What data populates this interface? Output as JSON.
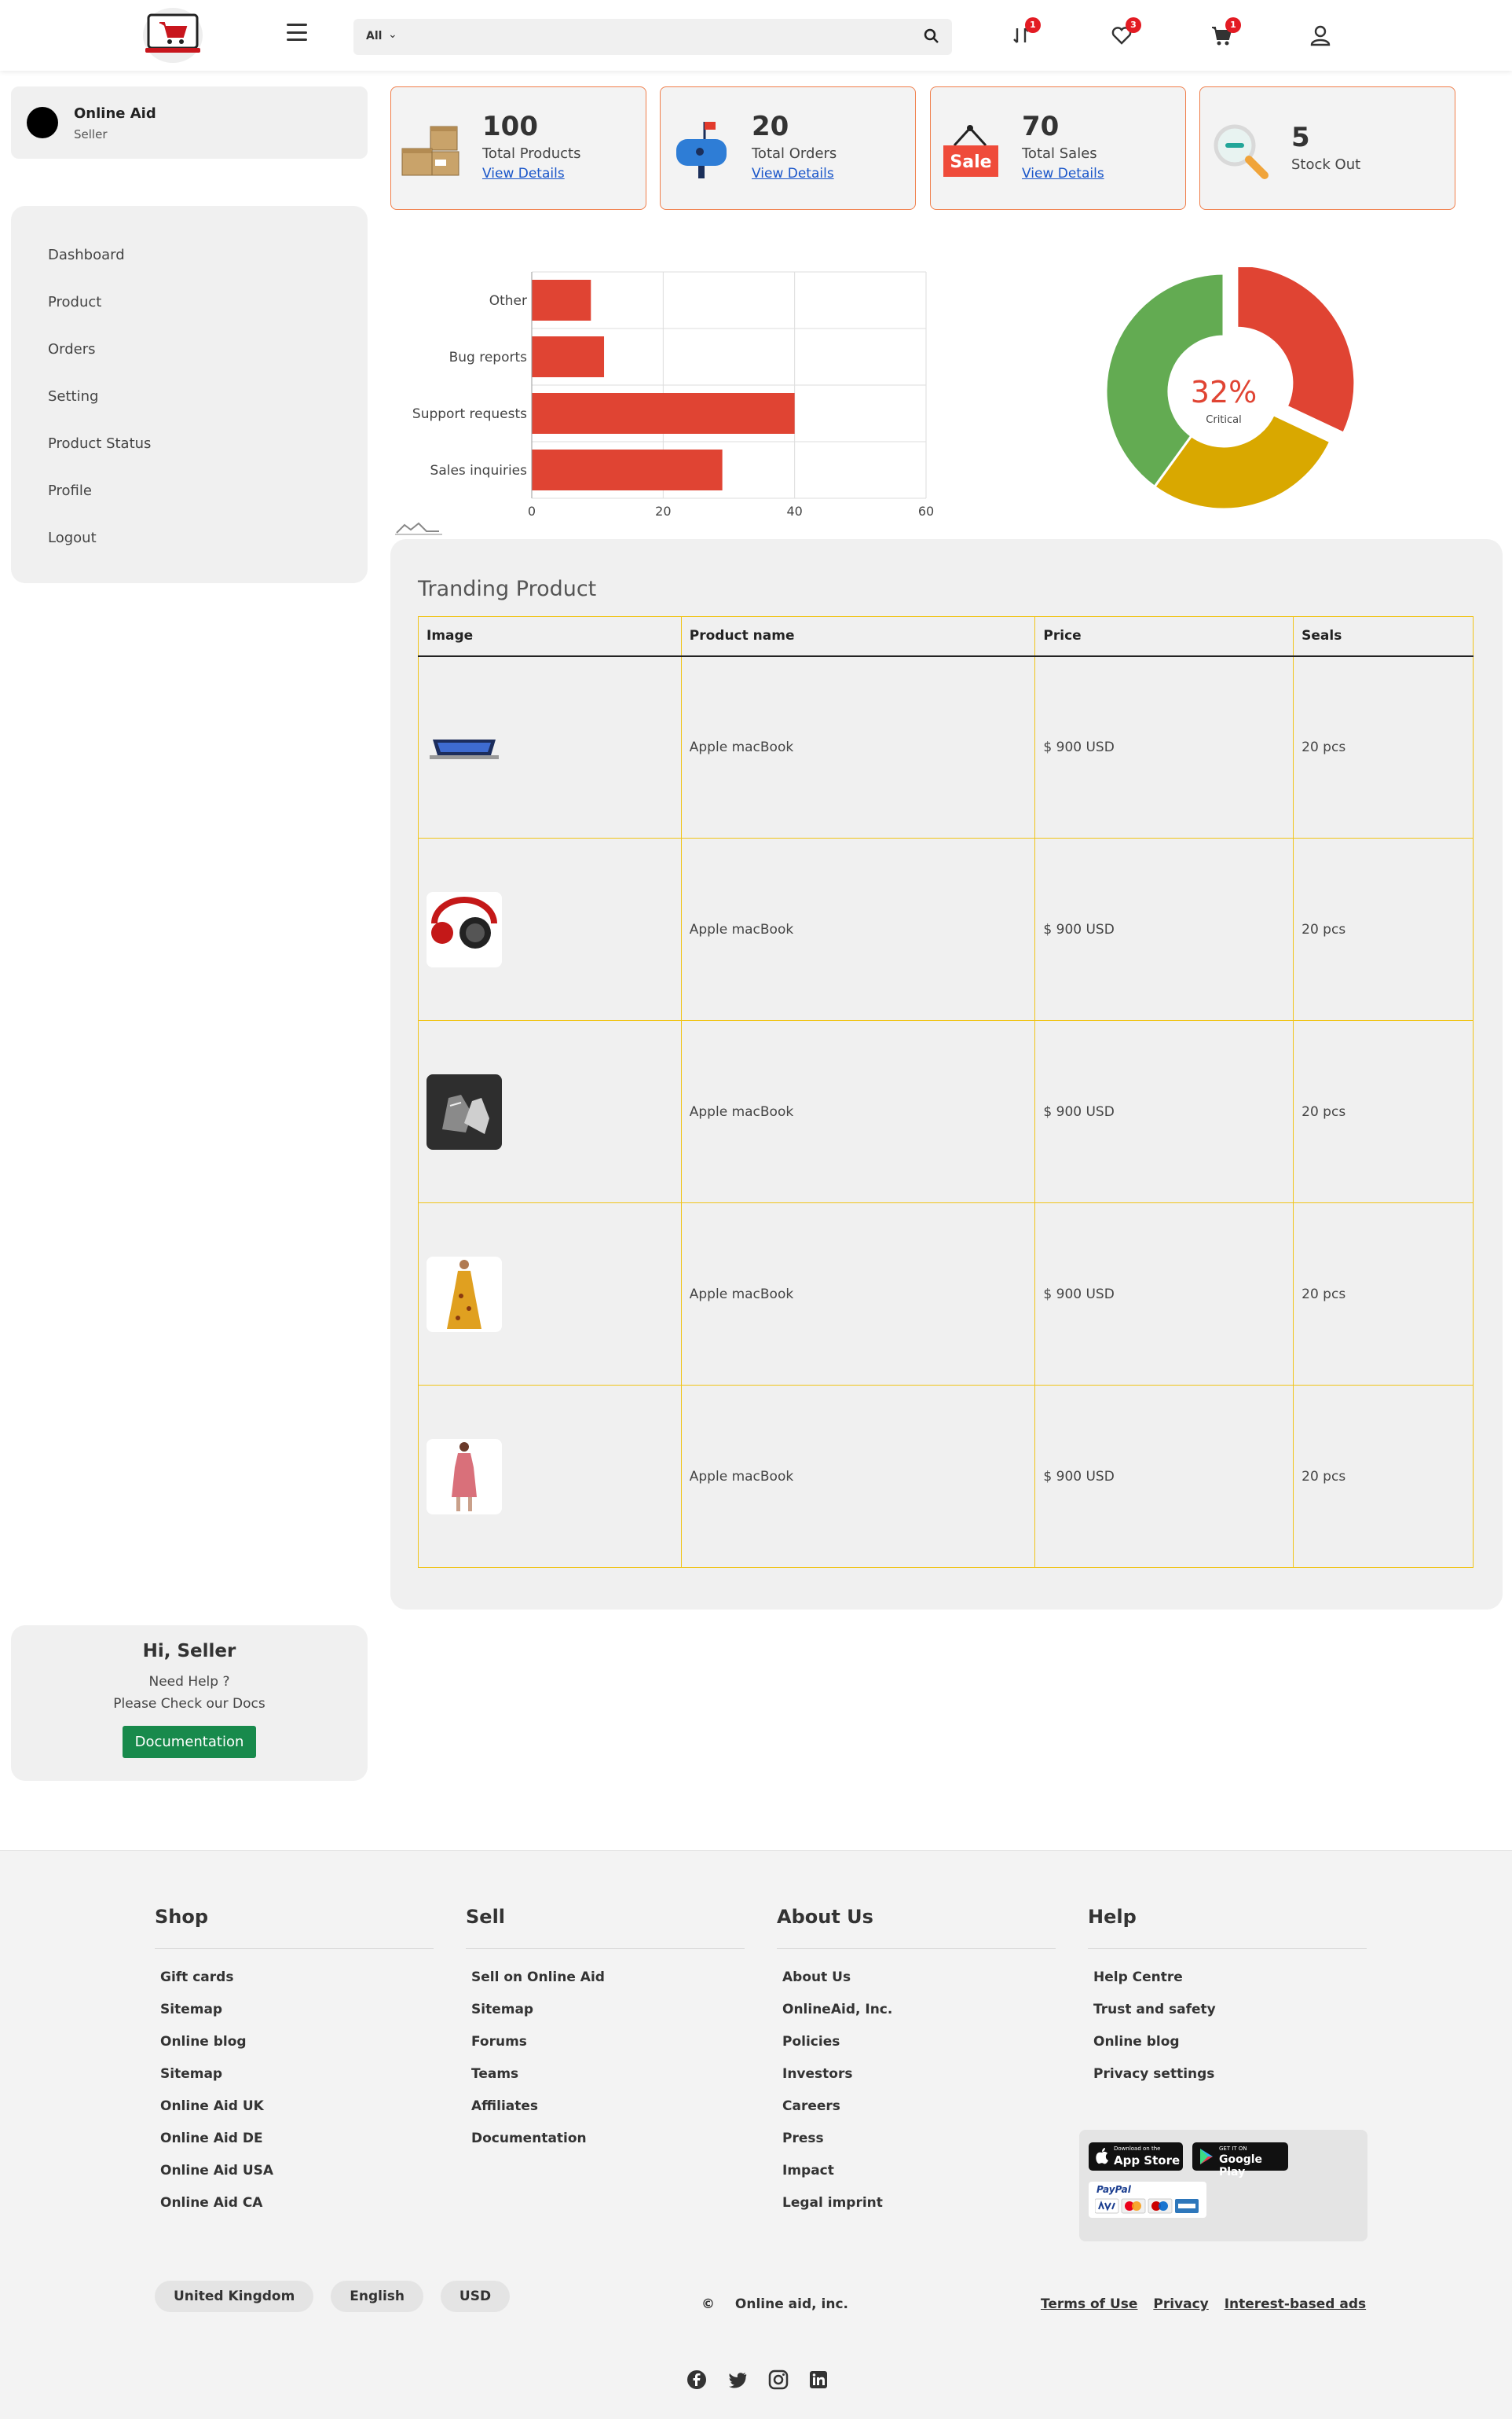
{
  "header": {
    "search_category": "All",
    "badges": {
      "compare": "1",
      "wishlist": "3",
      "cart": "1"
    }
  },
  "seller": {
    "name": "Online Aid",
    "role": "Seller"
  },
  "sidebar": {
    "items": [
      {
        "label": "Dashboard"
      },
      {
        "label": "Product"
      },
      {
        "label": "Orders"
      },
      {
        "label": "Setting"
      },
      {
        "label": "Product Status"
      },
      {
        "label": "Profile"
      },
      {
        "label": "Logout"
      }
    ]
  },
  "stats": [
    {
      "value": "100",
      "label": "Total Products",
      "link": "View Details"
    },
    {
      "value": "20",
      "label": "Total Orders",
      "link": "View Details"
    },
    {
      "value": "70",
      "label": "Total Sales",
      "link": "View Details",
      "icon_text": "Sale"
    },
    {
      "value": "5",
      "label": "Stock Out"
    }
  ],
  "chart_data": [
    {
      "type": "bar",
      "orientation": "horizontal",
      "categories": [
        "Other",
        "Bug reports",
        "Support requests",
        "Sales inquiries"
      ],
      "values": [
        9,
        11,
        40,
        29
      ],
      "xlim": [
        0,
        60
      ],
      "xticks": [
        "0",
        "20",
        "40",
        "60"
      ],
      "grid": true,
      "color": "#e04433"
    },
    {
      "type": "pie",
      "style": "donut",
      "center_value": "32%",
      "center_label": "Critical",
      "slices": [
        {
          "value": 32,
          "color": "#e04433"
        },
        {
          "value": 28,
          "color": "#d9a800"
        },
        {
          "value": 40,
          "color": "#63ab52"
        }
      ]
    }
  ],
  "trending": {
    "title": "Tranding Product",
    "columns": [
      "Image",
      "Product name",
      "Price",
      "Seals"
    ],
    "rows": [
      {
        "image": "laptop",
        "name": "Apple macBook",
        "price": "$ 900 USD",
        "sold": "20 pcs"
      },
      {
        "image": "headphones",
        "name": "Apple macBook",
        "price": "$ 900 USD",
        "sold": "20 pcs"
      },
      {
        "image": "sneakers",
        "name": "Apple macBook",
        "price": "$ 900 USD",
        "sold": "20 pcs"
      },
      {
        "image": "dress-yellow",
        "name": "Apple macBook",
        "price": "$ 900 USD",
        "sold": "20 pcs"
      },
      {
        "image": "dress-pink",
        "name": "Apple macBook",
        "price": "$ 900 USD",
        "sold": "20 pcs"
      }
    ]
  },
  "help": {
    "title": "Hi, Seller",
    "line1": "Need Help ?",
    "line2": "Please Check our Docs",
    "button": "Documentation"
  },
  "footer": {
    "columns": [
      {
        "title": "Shop",
        "links": [
          "Gift cards",
          "Sitemap",
          "Online blog",
          "Sitemap",
          "Online Aid UK",
          "Online Aid DE",
          "Online Aid USA",
          "Online Aid CA"
        ]
      },
      {
        "title": "Sell",
        "links": [
          "Sell on Online Aid",
          "Sitemap",
          "Forums",
          "Teams",
          "Affiliates",
          "Documentation"
        ]
      },
      {
        "title": "About Us",
        "links": [
          "About Us",
          "OnlineAid, Inc.",
          "Policies",
          "Investors",
          "Careers",
          "Press",
          "Impact",
          "Legal imprint"
        ]
      },
      {
        "title": "Help",
        "links": [
          "Help Centre",
          "Trust and safety",
          "Online blog",
          "Privacy settings"
        ]
      }
    ],
    "app_store": {
      "small": "Download on the",
      "big": "App Store"
    },
    "google_play": {
      "small": "GET IT ON",
      "big": "Google Play"
    },
    "paypal": "PayPal",
    "locale": [
      "United Kingdom",
      "English",
      "USD"
    ],
    "copyright_symbol": "©",
    "company": "Online aid, inc.",
    "legal_links": [
      "Terms of Use",
      "Privacy",
      "Interest-based ads"
    ]
  }
}
